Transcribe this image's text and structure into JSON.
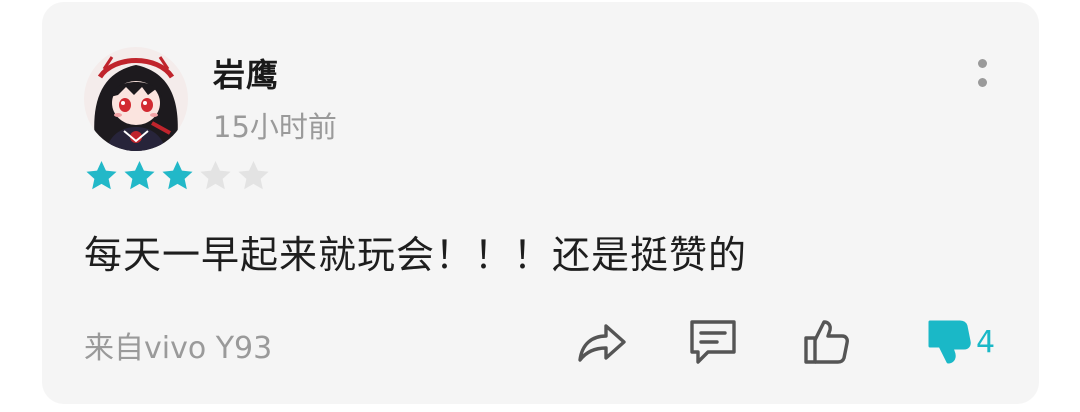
{
  "review": {
    "username": "岩鹰",
    "time_ago": "15小时前",
    "rating": 3,
    "max_rating": 5,
    "comment": "每天一早起来就玩会！！！还是挺赞的",
    "device": "来自vivo Y93",
    "dislike_count": "4"
  },
  "icons": {
    "more": "more-vertical-icon",
    "share": "share-icon",
    "reply": "comment-icon",
    "like": "thumbs-up-icon",
    "dislike": "thumbs-down-icon"
  },
  "colors": {
    "accent": "#1ab8c7",
    "star_filled": "#22b8c8",
    "star_empty": "#e3e3e3",
    "muted_text": "#9a9a9a",
    "card_bg": "#f5f5f5"
  }
}
